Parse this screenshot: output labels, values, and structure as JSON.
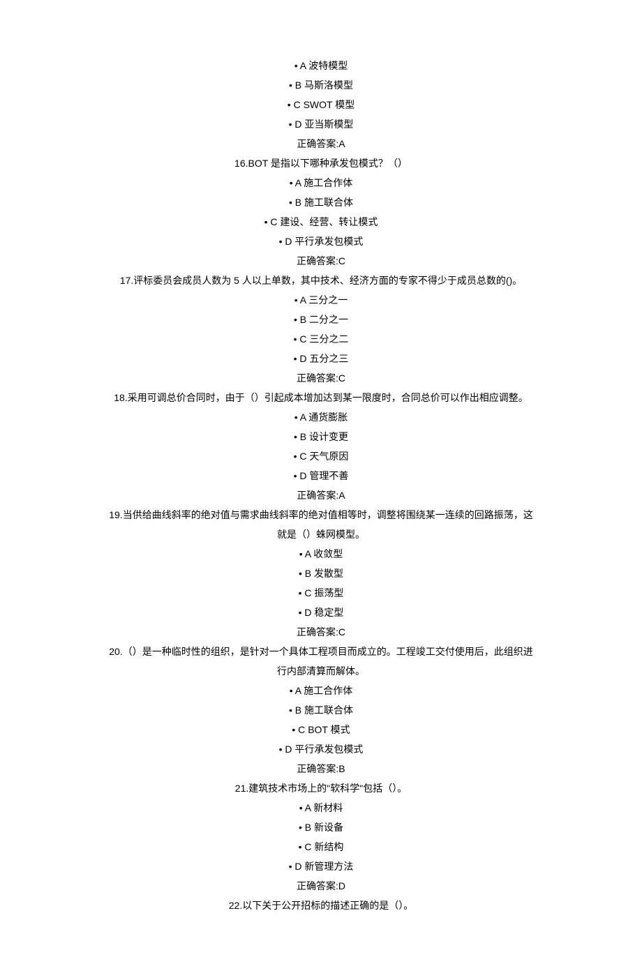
{
  "bullet": "•",
  "questions": [
    {
      "options": [
        {
          "letter": "A",
          "text": "波特模型"
        },
        {
          "letter": "B",
          "text": "马斯洛模型"
        },
        {
          "letter": "C",
          "text": "SWOT 模型"
        },
        {
          "letter": "D",
          "text": "亚当斯模型"
        }
      ],
      "answer_label": "正确答案:",
      "answer_value": "A"
    },
    {
      "number": "16.",
      "text": "BOT 是指以下哪种承发包模式？（）",
      "options": [
        {
          "letter": "A",
          "text": "施工合作体"
        },
        {
          "letter": "B",
          "text": "施工联合体"
        },
        {
          "letter": "C",
          "text": "建设、经营、转让模式"
        },
        {
          "letter": "D",
          "text": "平行承发包模式"
        }
      ],
      "answer_label": "正确答案:",
      "answer_value": "C"
    },
    {
      "number": "17.",
      "text": "评标委员会成员人数为 5 人以上单数，其中技术、经济方面的专家不得少于成员总数的()。",
      "options": [
        {
          "letter": "A",
          "text": "三分之一"
        },
        {
          "letter": "B",
          "text": "二分之一"
        },
        {
          "letter": "C",
          "text": "三分之二"
        },
        {
          "letter": "D",
          "text": "五分之三"
        }
      ],
      "answer_label": "正确答案:",
      "answer_value": "C"
    },
    {
      "number": "18.",
      "text": "采用可调总价合同时，由于（）引起成本增加达到某一限度时，合同总价可以作出相应调整。",
      "options": [
        {
          "letter": "A",
          "text": "通货膨胀"
        },
        {
          "letter": "B",
          "text": "设计变更"
        },
        {
          "letter": "C",
          "text": "天气原因"
        },
        {
          "letter": "D",
          "text": "管理不善"
        }
      ],
      "answer_label": "正确答案:",
      "answer_value": "A"
    },
    {
      "number": "19.",
      "text_line1": "当供给曲线斜率的绝对值与需求曲线斜率的绝对值相等时，调整将围绕某一连续的回路振荡，这",
      "text_line2": "就是（）蛛网模型。",
      "options": [
        {
          "letter": "A",
          "text": "收敛型"
        },
        {
          "letter": "B",
          "text": "发散型"
        },
        {
          "letter": "C",
          "text": "振荡型"
        },
        {
          "letter": "D",
          "text": "稳定型"
        }
      ],
      "answer_label": "正确答案:",
      "answer_value": "C"
    },
    {
      "number": "20.",
      "text_line1": "（）是一种临时性的组织，是针对一个具体工程项目而成立的。工程竣工交付使用后，此组织进",
      "text_line2": "行内部清算而解体。",
      "options": [
        {
          "letter": "A",
          "text": "施工合作体"
        },
        {
          "letter": "B",
          "text": "施工联合体"
        },
        {
          "letter": "C",
          "text": "BOT 模式"
        },
        {
          "letter": "D",
          "text": "平行承发包模式"
        }
      ],
      "answer_label": "正确答案:",
      "answer_value": "B"
    },
    {
      "number": "21.",
      "text": "建筑技术市场上的\"软科学\"包括（）。",
      "options": [
        {
          "letter": "A",
          "text": "新材料"
        },
        {
          "letter": "B",
          "text": "新设备"
        },
        {
          "letter": "C",
          "text": "新结构"
        },
        {
          "letter": "D",
          "text": "新管理方法"
        }
      ],
      "answer_label": "正确答案:",
      "answer_value": "D"
    },
    {
      "number": "22.",
      "text": "以下关于公开招标的描述正确的是（）。"
    }
  ]
}
